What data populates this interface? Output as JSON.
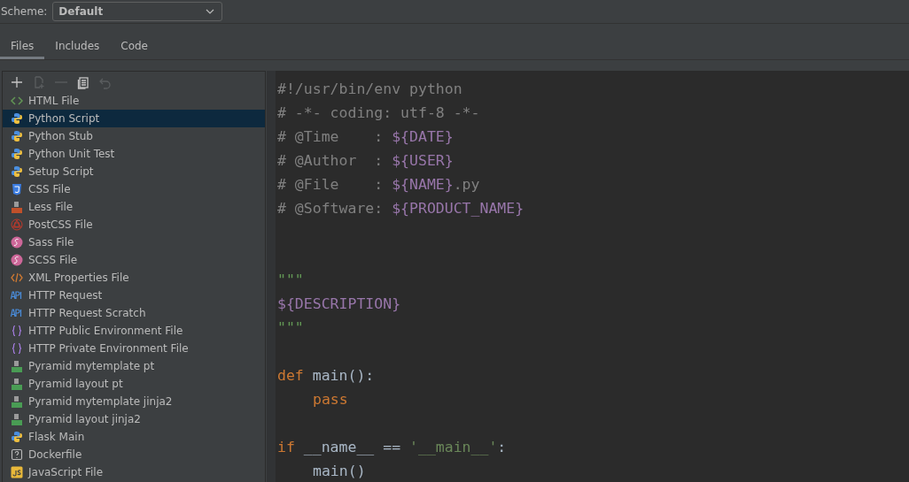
{
  "scheme": {
    "label": "Scheme:",
    "value": "Default"
  },
  "tabs": [
    {
      "label": "Files",
      "selected": true
    },
    {
      "label": "Includes",
      "selected": false
    },
    {
      "label": "Code",
      "selected": false
    }
  ],
  "toolbar": [
    {
      "kind": "add",
      "disabled": false
    },
    {
      "kind": "add-file",
      "disabled": true
    },
    {
      "kind": "remove",
      "disabled": true
    },
    {
      "kind": "copy",
      "disabled": false
    },
    {
      "kind": "undo",
      "disabled": true
    }
  ],
  "templates": [
    {
      "label": "HTML File",
      "kind": "html",
      "selected": false
    },
    {
      "label": "Python Script",
      "kind": "python",
      "selected": true
    },
    {
      "label": "Python Stub",
      "kind": "python",
      "selected": false
    },
    {
      "label": "Python Unit Test",
      "kind": "python",
      "selected": false
    },
    {
      "label": "Setup Script",
      "kind": "python",
      "selected": false
    },
    {
      "label": "CSS File",
      "kind": "css",
      "selected": false
    },
    {
      "label": "Less File",
      "kind": "less",
      "selected": false
    },
    {
      "label": "PostCSS File",
      "kind": "postcss",
      "selected": false
    },
    {
      "label": "Sass File",
      "kind": "sass",
      "selected": false
    },
    {
      "label": "SCSS File",
      "kind": "sass",
      "selected": false
    },
    {
      "label": "XML Properties File",
      "kind": "xml",
      "selected": false
    },
    {
      "label": "HTTP Request",
      "kind": "api",
      "selected": false
    },
    {
      "label": "HTTP Request Scratch",
      "kind": "api",
      "selected": false
    },
    {
      "label": "HTTP Public Environment File",
      "kind": "env",
      "selected": false
    },
    {
      "label": "HTTP Private Environment File",
      "kind": "env",
      "selected": false
    },
    {
      "label": "Pyramid mytemplate pt",
      "kind": "pyramid-c",
      "selected": false
    },
    {
      "label": "Pyramid layout pt",
      "kind": "pyramid-c",
      "selected": false
    },
    {
      "label": "Pyramid mytemplate jinja2",
      "kind": "pyramid-j2",
      "selected": false
    },
    {
      "label": "Pyramid layout jinja2",
      "kind": "pyramid-j2",
      "selected": false
    },
    {
      "label": "Flask Main",
      "kind": "python",
      "selected": false
    },
    {
      "label": "Dockerfile",
      "kind": "unknown",
      "selected": false
    },
    {
      "label": "JavaScript File",
      "kind": "js",
      "selected": false
    }
  ],
  "code_lines": [
    {
      "tokens": [
        {
          "kind": "comment",
          "text": "#!/usr/bin/env python"
        }
      ]
    },
    {
      "tokens": [
        {
          "kind": "comment",
          "text": "# -*- coding: utf-8 -*-"
        }
      ]
    },
    {
      "tokens": [
        {
          "kind": "comment",
          "text": "# @Time    : "
        },
        {
          "kind": "var",
          "text": "${DATE}"
        }
      ]
    },
    {
      "tokens": [
        {
          "kind": "comment",
          "text": "# @Author  : "
        },
        {
          "kind": "var",
          "text": "${USER}"
        }
      ]
    },
    {
      "tokens": [
        {
          "kind": "comment",
          "text": "# @File    : "
        },
        {
          "kind": "var",
          "text": "${NAME}"
        },
        {
          "kind": "comment",
          "text": ".py"
        }
      ]
    },
    {
      "tokens": [
        {
          "kind": "comment",
          "text": "# @Software: "
        },
        {
          "kind": "var",
          "text": "${PRODUCT_NAME}"
        }
      ]
    },
    {
      "tokens": [
        {
          "kind": "doc",
          "text": "\"\"\""
        }
      ],
      "blank_above": true,
      "wide_blank": true
    },
    {
      "tokens": [
        {
          "kind": "var",
          "text": "${DESCRIPTION}"
        }
      ]
    },
    {
      "tokens": [
        {
          "kind": "doc",
          "text": "\"\"\""
        }
      ]
    },
    {
      "tokens": [
        {
          "kind": "keyword",
          "text": "def"
        },
        {
          "kind": "plain",
          "text": " main():"
        }
      ],
      "blank_above": true
    },
    {
      "tokens": [
        {
          "kind": "keyword",
          "text": "pass"
        }
      ],
      "indented": true
    },
    {
      "tokens": [
        {
          "kind": "keyword",
          "text": "if"
        },
        {
          "kind": "plain",
          "text": " __name__ == "
        },
        {
          "kind": "string",
          "text": "'__main__'"
        },
        {
          "kind": "plain",
          "text": ":"
        }
      ],
      "blank_above": true
    },
    {
      "tokens": [
        {
          "kind": "plain",
          "text": "main()"
        }
      ],
      "indented": true
    }
  ]
}
